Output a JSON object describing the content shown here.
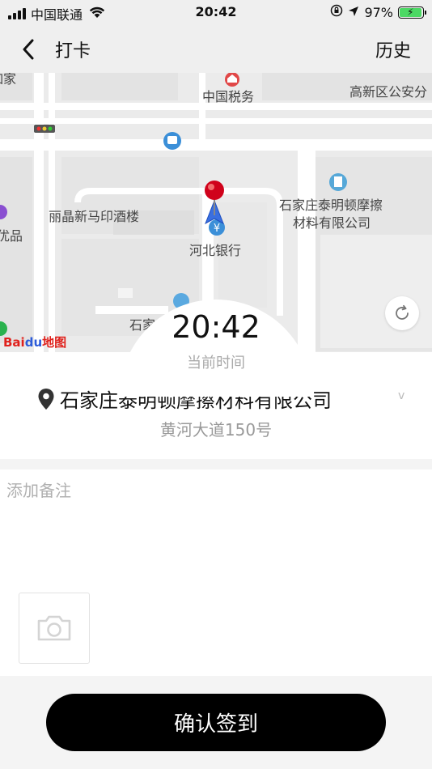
{
  "status_bar": {
    "carrier": "中国联通",
    "time": "20:42",
    "battery_percent": "97%",
    "battery_level": 0.97,
    "icons": [
      "signal-icon",
      "wifi-icon",
      "orientation-lock-icon",
      "location-arrow-icon",
      "battery-charging-icon"
    ]
  },
  "nav": {
    "title": "打卡",
    "history_label": "历史",
    "back_icon": "chevron-left-icon"
  },
  "map": {
    "labels": {
      "top_left_partial": "如家",
      "tax": "中国税务",
      "police": "高新区公安分",
      "hotel": "丽晶新马印酒楼",
      "company_line1": "石家庄泰明顿摩擦",
      "company_line2": "材料有限公司",
      "bank": "河北银行",
      "left_partial": "优品",
      "bottom_partial": "石家"
    },
    "logo_baidu": "Bai",
    "logo_du": "du",
    "logo_map": "地图",
    "refresh_icon": "refresh-icon",
    "pin_icon": "map-pin-icon",
    "colors": {
      "road": "#ffffff",
      "block": "#e6e6e6",
      "pin": "#d0021b",
      "arrow": "#3a6fe0"
    }
  },
  "clock": {
    "time": "20:42",
    "caption": "当前时间"
  },
  "location": {
    "name": "石家庄泰明顿摩擦材料有限公司",
    "address": "黄河大道150号",
    "chevron": "v",
    "icon": "location-pin-icon"
  },
  "note": {
    "placeholder": "添加备注",
    "camera_icon": "camera-icon"
  },
  "confirm": {
    "label": "确认签到"
  }
}
